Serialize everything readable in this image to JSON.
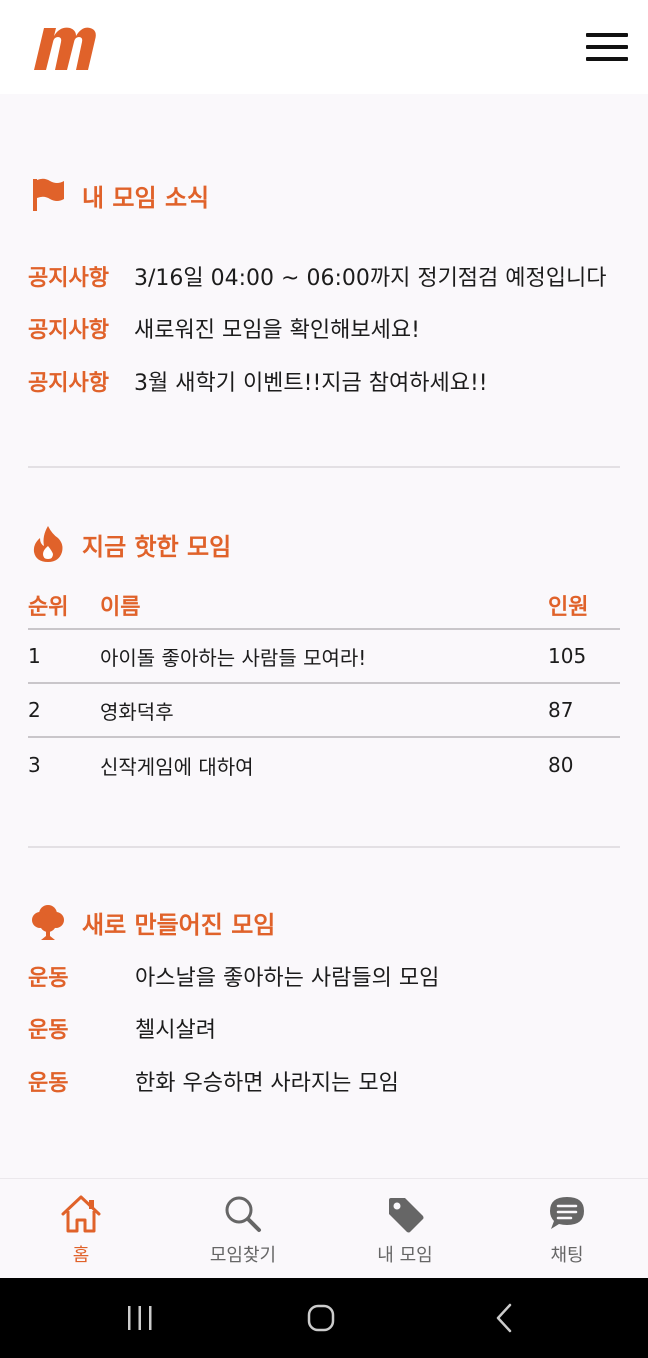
{
  "header": {
    "logo_letter": "m"
  },
  "my_group_news": {
    "title": "내 모임 소식",
    "items": [
      {
        "tag": "공지사항",
        "text": "3/16일 04:00 ~ 06:00까지 정기점검 예정입니다"
      },
      {
        "tag": "공지사항",
        "text": "새로워진 모임을 확인해보세요!"
      },
      {
        "tag": "공지사항",
        "text": "3월 새학기 이벤트!!지금 참여하세요!!"
      }
    ]
  },
  "hot_groups": {
    "title": "지금 핫한 모임",
    "columns": {
      "rank": "순위",
      "name": "이름",
      "count": "인원"
    },
    "rows": [
      {
        "rank": "1",
        "name": "아이돌 좋아하는 사람들 모여라!",
        "count": "105"
      },
      {
        "rank": "2",
        "name": "영화덕후",
        "count": "87"
      },
      {
        "rank": "3",
        "name": "신작게임에 대하여",
        "count": "80"
      }
    ]
  },
  "new_groups": {
    "title": "새로 만들어진 모임",
    "items": [
      {
        "category": "운동",
        "name": "아스날을 좋아하는 사람들의 모임"
      },
      {
        "category": "운동",
        "name": "첼시살려"
      },
      {
        "category": "운동",
        "name": "한화 우승하면 사라지는 모임"
      }
    ]
  },
  "bottom_nav": {
    "home": "홈",
    "find": "모임찾기",
    "my": "내 모임",
    "chat": "채팅"
  },
  "colors": {
    "accent": "#e0622a",
    "inactive": "#666666"
  }
}
